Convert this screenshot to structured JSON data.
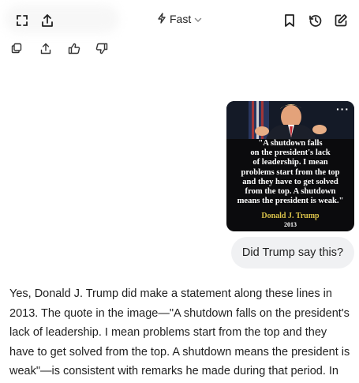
{
  "header": {
    "model_label": "Fast",
    "icons": {
      "expand": "expand-icon",
      "share": "share-icon",
      "bookmark": "bookmark-icon",
      "history": "history-icon",
      "new_chat": "edit-icon",
      "dropdown": "chevron-down-icon",
      "model": "lightning-icon"
    }
  },
  "message_actions": {
    "icons": [
      "copy-icon",
      "share-icon",
      "thumbs-up-icon",
      "thumbs-down-icon"
    ]
  },
  "user_message": {
    "image": {
      "quote_lines": [
        "\"A shutdown falls",
        "on the president's lack",
        "of leadership. I mean",
        "problems start from the top",
        "and they have to get solved",
        "from the top. A shutdown",
        "means the president is weak.\""
      ],
      "attribution_name": "Donald J. Trump",
      "attribution_year": "2013",
      "menu": "···"
    },
    "text": "Did Trump say this?"
  },
  "assistant_message": {
    "lines": [
      "Yes, Donald J. Trump did make a statement along these lines in",
      "2013. The quote in the image—\"A shutdown falls on the president's",
      "lack of leadership. I mean problems start from the top and they",
      "have to get solved from the top. A shutdown means the president is",
      "weak\"—is consistent with remarks he made during that period. In"
    ]
  },
  "colors": {
    "attribution_name": "#d9c24a",
    "bubble_bg": "#f0f1f3",
    "image_bg": "#0b0b0d"
  }
}
